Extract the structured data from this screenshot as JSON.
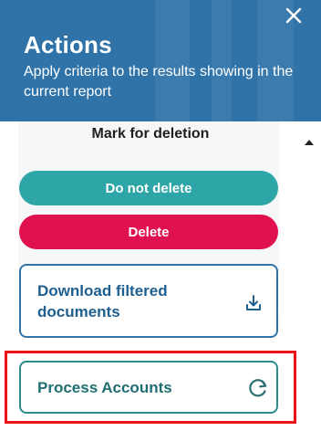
{
  "header": {
    "title": "Actions",
    "subtitle": "Apply criteria to the results showing in the current report",
    "close_icon": "close-icon",
    "background_color": "#2f73a8"
  },
  "section": {
    "mark_label": "Mark for deletion"
  },
  "buttons": {
    "do_not_delete": "Do not delete",
    "delete": "Delete",
    "download_filtered": "Download filtered documents",
    "download_icon": "download-icon",
    "process_accounts": "Process Accounts",
    "process_icon": "refresh-icon"
  },
  "colors": {
    "teal": "#2ea6a8",
    "red": "#e0114f",
    "blue_outline": "#2f73a8",
    "teal_outline": "#2b8a8c",
    "highlight": "#e8141a"
  }
}
